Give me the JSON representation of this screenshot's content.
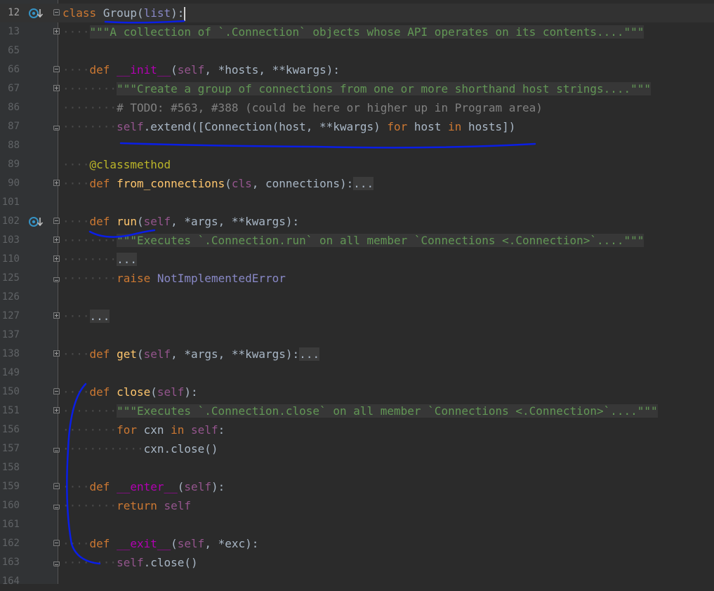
{
  "editor": {
    "lines": [
      {
        "num": "12",
        "indent": "",
        "current": true,
        "parts": [
          {
            "t": "class",
            "c": "kw"
          },
          {
            "t": " "
          },
          {
            "t": "Group"
          },
          {
            "t": "("
          },
          {
            "t": "list",
            "c": "builtin"
          },
          {
            "t": "):"
          }
        ]
      },
      {
        "num": "13",
        "indent": "····",
        "parts": [
          {
            "t": "\"\"\"A collection of `.Connection` objects whose API operates on its contents....\"\"\"",
            "c": "doc-block"
          }
        ]
      },
      {
        "num": "65",
        "indent": "",
        "parts": []
      },
      {
        "num": "66",
        "indent": "····",
        "parts": [
          {
            "t": "def",
            "c": "kw"
          },
          {
            "t": " "
          },
          {
            "t": "__init__",
            "c": "magic"
          },
          {
            "t": "("
          },
          {
            "t": "self",
            "c": "self"
          },
          {
            "t": ", *hosts, **kwargs):"
          }
        ]
      },
      {
        "num": "67",
        "indent": "········",
        "parts": [
          {
            "t": "\"\"\"Create a group of connections from one or more shorthand host strings....\"\"\"",
            "c": "doc-block"
          }
        ]
      },
      {
        "num": "86",
        "indent": "········",
        "parts": [
          {
            "t": "# TODO: #563, #388 (could be here or higher up in Program area)",
            "c": "cmt"
          }
        ]
      },
      {
        "num": "87",
        "indent": "········",
        "parts": [
          {
            "t": "self",
            "c": "self"
          },
          {
            "t": ".extend([Connection(host, **kwargs) "
          },
          {
            "t": "for",
            "c": "kw"
          },
          {
            "t": " host "
          },
          {
            "t": "in",
            "c": "kw"
          },
          {
            "t": " hosts])"
          }
        ]
      },
      {
        "num": "88",
        "indent": "",
        "parts": []
      },
      {
        "num": "89",
        "indent": "····",
        "parts": [
          {
            "t": "@classmethod",
            "c": "deco"
          }
        ]
      },
      {
        "num": "90",
        "indent": "····",
        "parts": [
          {
            "t": "def",
            "c": "kw"
          },
          {
            "t": " "
          },
          {
            "t": "from_connections",
            "c": "fn"
          },
          {
            "t": "("
          },
          {
            "t": "cls",
            "c": "self"
          },
          {
            "t": ", connections):"
          },
          {
            "t": "...",
            "c": "fold-block"
          }
        ]
      },
      {
        "num": "101",
        "indent": "",
        "parts": []
      },
      {
        "num": "102",
        "indent": "····",
        "parts": [
          {
            "t": "def",
            "c": "kw"
          },
          {
            "t": " "
          },
          {
            "t": "run",
            "c": "fn"
          },
          {
            "t": "("
          },
          {
            "t": "self",
            "c": "self"
          },
          {
            "t": ", *args, **kwargs):"
          }
        ]
      },
      {
        "num": "103",
        "indent": "········",
        "parts": [
          {
            "t": "\"\"\"Executes `.Connection.run` on all member `Connections <.Connection>`....\"\"\"",
            "c": "doc-block"
          }
        ]
      },
      {
        "num": "110",
        "indent": "········",
        "parts": [
          {
            "t": "...",
            "c": "fold-block"
          }
        ]
      },
      {
        "num": "125",
        "indent": "········",
        "parts": [
          {
            "t": "raise",
            "c": "kw"
          },
          {
            "t": " "
          },
          {
            "t": "NotImplementedError",
            "c": "builtin"
          }
        ]
      },
      {
        "num": "126",
        "indent": "",
        "parts": []
      },
      {
        "num": "127",
        "indent": "····",
        "parts": [
          {
            "t": "...",
            "c": "fold-block"
          }
        ]
      },
      {
        "num": "137",
        "indent": "",
        "parts": []
      },
      {
        "num": "138",
        "indent": "····",
        "parts": [
          {
            "t": "def",
            "c": "kw"
          },
          {
            "t": " "
          },
          {
            "t": "get",
            "c": "fn"
          },
          {
            "t": "("
          },
          {
            "t": "self",
            "c": "self"
          },
          {
            "t": ", *args, **kwargs):"
          },
          {
            "t": "...",
            "c": "fold-block"
          }
        ]
      },
      {
        "num": "149",
        "indent": "",
        "parts": []
      },
      {
        "num": "150",
        "indent": "····",
        "parts": [
          {
            "t": "def",
            "c": "kw"
          },
          {
            "t": " "
          },
          {
            "t": "close",
            "c": "fn"
          },
          {
            "t": "("
          },
          {
            "t": "self",
            "c": "self"
          },
          {
            "t": "):"
          }
        ]
      },
      {
        "num": "151",
        "indent": "········",
        "parts": [
          {
            "t": "\"\"\"Executes `.Connection.close` on all member `Connections <.Connection>`....\"\"\"",
            "c": "doc-block"
          }
        ]
      },
      {
        "num": "156",
        "indent": "········",
        "parts": [
          {
            "t": "for",
            "c": "kw"
          },
          {
            "t": " cxn "
          },
          {
            "t": "in",
            "c": "kw"
          },
          {
            "t": " "
          },
          {
            "t": "self",
            "c": "self"
          },
          {
            "t": ":"
          }
        ]
      },
      {
        "num": "157",
        "indent": "············",
        "parts": [
          {
            "t": "cxn.close()"
          }
        ]
      },
      {
        "num": "158",
        "indent": "",
        "parts": []
      },
      {
        "num": "159",
        "indent": "····",
        "parts": [
          {
            "t": "def",
            "c": "kw"
          },
          {
            "t": " "
          },
          {
            "t": "__enter__",
            "c": "magic"
          },
          {
            "t": "("
          },
          {
            "t": "self",
            "c": "self"
          },
          {
            "t": "):"
          }
        ]
      },
      {
        "num": "160",
        "indent": "········",
        "parts": [
          {
            "t": "return",
            "c": "kw"
          },
          {
            "t": " "
          },
          {
            "t": "self",
            "c": "self"
          }
        ]
      },
      {
        "num": "161",
        "indent": "",
        "parts": []
      },
      {
        "num": "162",
        "indent": "····",
        "parts": [
          {
            "t": "def",
            "c": "kw"
          },
          {
            "t": " "
          },
          {
            "t": "__exit__",
            "c": "magic"
          },
          {
            "t": "("
          },
          {
            "t": "self",
            "c": "self"
          },
          {
            "t": ", *exc):"
          }
        ]
      },
      {
        "num": "163",
        "indent": "········",
        "parts": [
          {
            "t": "self",
            "c": "self"
          },
          {
            "t": ".close()"
          }
        ]
      },
      {
        "num": "164",
        "indent": "",
        "parts": []
      }
    ],
    "fold_markers": {
      "12": "start",
      "13": "plus",
      "66": "start",
      "67": "plus",
      "87": "end",
      "90": "plus",
      "102": "start",
      "103": "plus",
      "110": "plus",
      "125": "end",
      "127": "plus",
      "138": "plus",
      "150": "start",
      "151": "plus",
      "157": "end",
      "159": "start",
      "160": "end",
      "162": "start",
      "163": "end"
    },
    "override_icon_lines": [
      "12",
      "102"
    ],
    "icons": {
      "override": "override-method-icon",
      "fold": "fold-toggle-icon"
    },
    "colors": {
      "background": "#2b2b2b",
      "gutter": "#313335",
      "keyword": "#cc7832",
      "self": "#94558d",
      "function": "#ffc66d",
      "docstring": "#629755",
      "comment": "#808080",
      "annotation": "#0a1ee6"
    }
  }
}
